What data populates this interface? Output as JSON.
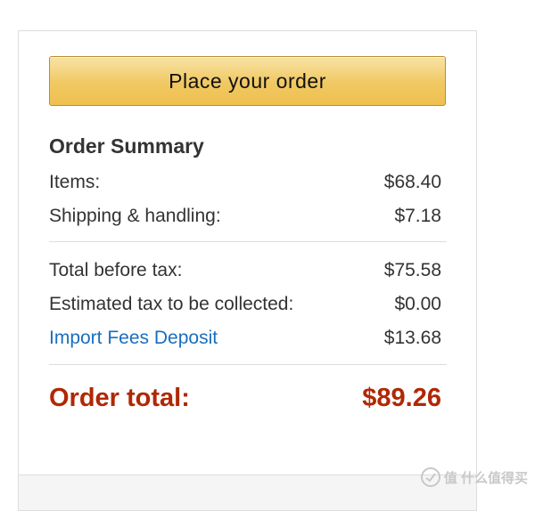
{
  "order_button": {
    "label": "Place your order"
  },
  "summary": {
    "title": "Order Summary",
    "items": {
      "label": "Items:",
      "value": "$68.40"
    },
    "shipping": {
      "label": "Shipping & handling:",
      "value": "$7.18"
    },
    "total_before_tax": {
      "label": "Total before tax:",
      "value": "$75.58"
    },
    "estimated_tax": {
      "label": "Estimated tax to be collected:",
      "value": "$0.00"
    },
    "import_fees": {
      "label": "Import Fees Deposit",
      "value": "$13.68"
    },
    "order_total": {
      "label": "Order total:",
      "value": "$89.26"
    }
  },
  "watermark": {
    "text": "值 什么值得买"
  },
  "colors": {
    "button_gradient_top": "#f8e3a5",
    "button_gradient_bottom": "#eec04f",
    "link": "#1a6ebf",
    "total": "#b12704"
  }
}
